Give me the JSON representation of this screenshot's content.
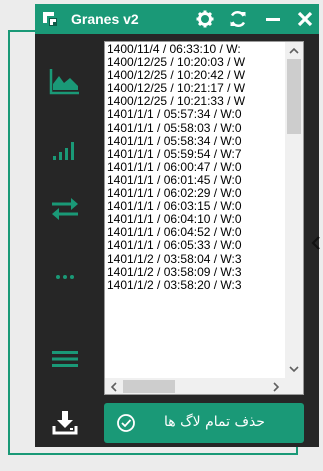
{
  "app": {
    "title": "Granes v2"
  },
  "titlebar": {
    "icons": [
      "settings-icon",
      "refresh-icon",
      "minimize-icon",
      "close-icon"
    ]
  },
  "sidebar": {
    "items": [
      {
        "name": "area-chart-icon"
      },
      {
        "name": "bar-chart-icon"
      },
      {
        "name": "transfer-icon"
      },
      {
        "name": "more-icon"
      },
      {
        "name": "menu-icon"
      },
      {
        "name": "download-icon"
      }
    ]
  },
  "logs": [
    "1400/11/4 / 06:33:10 / W:",
    "1400/12/25 / 10:20:03 / W",
    "1400/12/25 / 10:20:42 / W",
    "1400/12/25 / 10:21:17 / W",
    "1400/12/25 / 10:21:33 / W",
    "1401/1/1 / 05:57:34 / W:0",
    "1401/1/1 / 05:58:03 / W:0",
    "1401/1/1 / 05:58:34 / W:0",
    "1401/1/1 / 05:59:54 / W:7",
    "1401/1/1 / 06:00:47 / W:0",
    "1401/1/1 / 06:01:45 / W:0",
    "1401/1/1 / 06:02:29 / W:0",
    "1401/1/1 / 06:03:15 / W:0",
    "1401/1/1 / 06:04:10 / W:0",
    "1401/1/1 / 06:04:52 / W:0",
    "1401/1/1 / 06:05:33 / W:0",
    "1401/1/2 / 03:58:04 / W:3",
    "1401/1/2 / 03:58:09 / W:3",
    "1401/1/2 / 03:58:20 / W:3"
  ],
  "actions": {
    "delete_all_logs": "حذف تمام لاگ ها"
  },
  "colors": {
    "accent": "#1a9977",
    "window_bg": "#262626",
    "list_bg": "#ffffff"
  }
}
